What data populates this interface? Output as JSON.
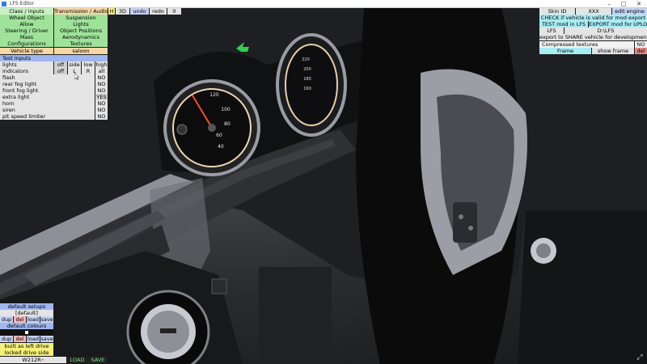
{
  "window": {
    "title": "LFS Editor",
    "minimize": "–",
    "maximize": "□",
    "close": "✕"
  },
  "left_panel": {
    "tabs": [
      [
        "Class / inputs",
        "Transmission / Audio"
      ],
      [
        "Wheel Object",
        "Suspension"
      ],
      [
        "Allow",
        "Lights"
      ],
      [
        "Steering / Driver",
        "Object Positions"
      ],
      [
        "Mass",
        "Aerodynamics"
      ],
      [
        "Configurations",
        "Textures"
      ]
    ],
    "vehicle_type_label": "Vehicle type",
    "vehicle_type_value": "saloon",
    "test_inputs_header": "Test inputs",
    "lights": {
      "label": "lights",
      "options": [
        "off",
        "side",
        "low",
        "high"
      ]
    },
    "indicators": {
      "label": "indicators",
      "options": [
        "off",
        "L",
        "R",
        "all"
      ]
    },
    "rows": [
      {
        "label": "flash",
        "value": "NO"
      },
      {
        "label": "rear fog light",
        "value": "NO"
      },
      {
        "label": "front fog light",
        "value": "NO"
      },
      {
        "label": "extra light",
        "value": "YES"
      },
      {
        "label": "horn",
        "value": "NO"
      },
      {
        "label": "siren",
        "value": "NO"
      },
      {
        "label": "pit speed limiter",
        "value": "NO"
      }
    ]
  },
  "top_toolbar": {
    "h": "H",
    "view": "3D",
    "undo": "undo",
    "redo": "redo",
    "count": "0"
  },
  "right_panel": {
    "skin_label": "Skin ID",
    "skin_value": "XXX",
    "edit_engine": "edit engine",
    "check_valid": "CHECK if vehicle is valid for mod export",
    "test_mod": "TEST mod in LFS",
    "export_mod": "EXPORT mod for UPLOAD",
    "lfs_label": "LFS",
    "lfs_path": "D:\\LFS",
    "export_share": "export to SHARE vehicle for development",
    "compressed_label": "Compressed textures",
    "compressed_value": "NO",
    "frame": "Frame",
    "show_frame": "show frame",
    "del": "del"
  },
  "bottom_left": {
    "default_setups": "default setups",
    "default_value": "[default]",
    "setup_buttons": [
      "dup",
      "del",
      "load",
      "save"
    ],
    "default_colours": "default colours",
    "colour_buttons": [
      "dup",
      "del",
      "load",
      "save"
    ],
    "left_drive": "built as left drive",
    "locked_drive": "locked drive side",
    "model_name": "W212R",
    "model_marker": "•",
    "load": "LOAD",
    "save": "SAVE"
  },
  "speedometer_ticks": [
    "120",
    "100",
    "80",
    "60",
    "40"
  ],
  "tacho_ticks": [
    "220",
    "200",
    "180",
    "160"
  ],
  "icons": {
    "app": "app-icon",
    "fullscreen": "fullscreen-icon",
    "cursor": "mouse-cursor"
  }
}
